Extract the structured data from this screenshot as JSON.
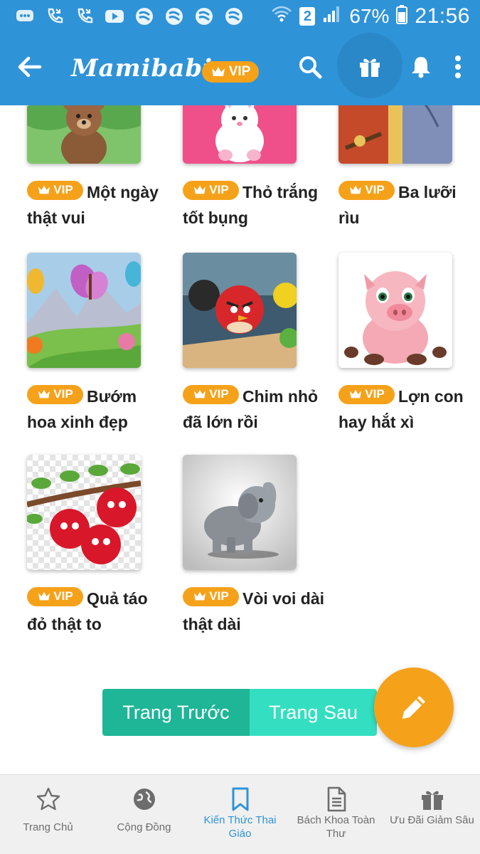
{
  "status_bar": {
    "battery_percent": "67%",
    "time": "21:56",
    "sim_slot": "2",
    "notification_icons": [
      "message-icon",
      "missed-call-icon",
      "missed-call-icon",
      "youtube-icon",
      "app-icon",
      "app-icon",
      "app-icon",
      "app-icon"
    ]
  },
  "app_bar": {
    "brand": "Mamibabi",
    "vip_label": "VIP",
    "icons": [
      "back-arrow-icon",
      "search-icon",
      "gift-icon",
      "bell-icon",
      "more-vert-icon"
    ]
  },
  "items": [
    {
      "vip": "VIP",
      "title": "Một ngày thật vui",
      "image": "teddy-bear"
    },
    {
      "vip": "VIP",
      "title": "Thỏ trắng tốt bụng",
      "image": "white-rabbit"
    },
    {
      "vip": "VIP",
      "title": "Ba lưỡi rìu",
      "image": "woodcutter"
    },
    {
      "vip": "VIP",
      "title": "Bướm hoa xinh đẹp",
      "image": "butterflies"
    },
    {
      "vip": "VIP",
      "title": "Chim nhỏ đã lớn rồi",
      "image": "red-bird"
    },
    {
      "vip": "VIP",
      "title": "Lợn con hay hắt xì",
      "image": "piglet"
    },
    {
      "vip": "VIP",
      "title": "Quả táo đỏ thật to",
      "image": "red-apples"
    },
    {
      "vip": "VIP",
      "title": "Vòi voi dài thật dài",
      "image": "elephant"
    }
  ],
  "pagination": {
    "prev_label": "Trang Trước",
    "next_label": "Trang Sau"
  },
  "fab": {
    "icon": "pencil-icon"
  },
  "bottom_nav": [
    {
      "label": "Trang Chủ",
      "icon": "star-icon",
      "active": false
    },
    {
      "label": "Cộng Đồng",
      "icon": "globe-icon",
      "active": false
    },
    {
      "label": "Kiến Thức Thai Giáo",
      "icon": "bookmark-icon",
      "active": true
    },
    {
      "label": "Bách Khoa Toàn Thư",
      "icon": "document-icon",
      "active": false
    },
    {
      "label": "Ưu Đãi Giảm Sâu",
      "icon": "gift-icon",
      "active": false
    }
  ],
  "colors": {
    "primary": "#2f93d8",
    "vip_orange": "#f5a21a",
    "prev_button": "#1fb597",
    "next_button": "#33dfc0"
  }
}
